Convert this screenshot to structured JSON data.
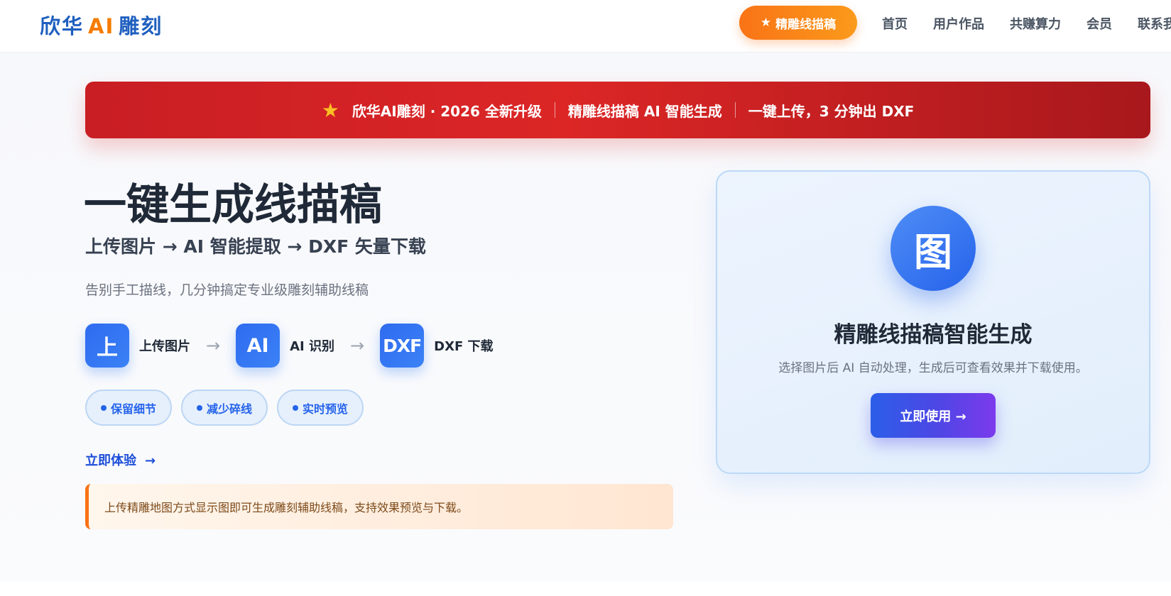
{
  "header": {
    "logo_left": "欣华",
    "logo_ai": "AI",
    "logo_right": "雕刻",
    "cta_star": "★",
    "cta_label": "精雕线描稿",
    "nav": [
      "首页",
      "用户作品",
      "共赚算力",
      "会员",
      "联系我们"
    ]
  },
  "banner": {
    "star": "★",
    "items": [
      "欣华AI雕刻 · 2026 全新升级",
      "精雕线描稿 AI 智能生成",
      "一键上传，3 分钟出 DXF"
    ]
  },
  "hero": {
    "title": "一键生成线描稿",
    "subtitle": "上传图片 → AI 智能提取 → DXF 矢量下载",
    "description": "告别手工描线，几分钟搞定专业级雕刻辅助线稿",
    "steps": [
      {
        "icon_text": "上",
        "label": "上传图片"
      },
      {
        "icon_text": "AI",
        "label": "AI 识别"
      },
      {
        "icon_text": "DXF",
        "label": "DXF 下载"
      }
    ],
    "step_arrow": "→",
    "tags": [
      "保留细节",
      "减少碎线",
      "实时预览"
    ],
    "try_link": "立即体验",
    "try_arrow": "→",
    "notice": "上传精雕地图方式显示图即可生成雕刻辅助线稿，支持效果预览与下载。"
  },
  "card": {
    "icon_text": "图",
    "title": "精雕线描稿智能生成",
    "description": "选择图片后 AI 自动处理，生成后可查看效果并下载使用。",
    "button": "立即使用 →"
  },
  "colors": {
    "brand_blue": "#1f5fbf",
    "accent_orange": "#f97316",
    "banner_red": "#dc2626",
    "primary_blue": "#2563eb",
    "purple": "#7c3aed"
  }
}
